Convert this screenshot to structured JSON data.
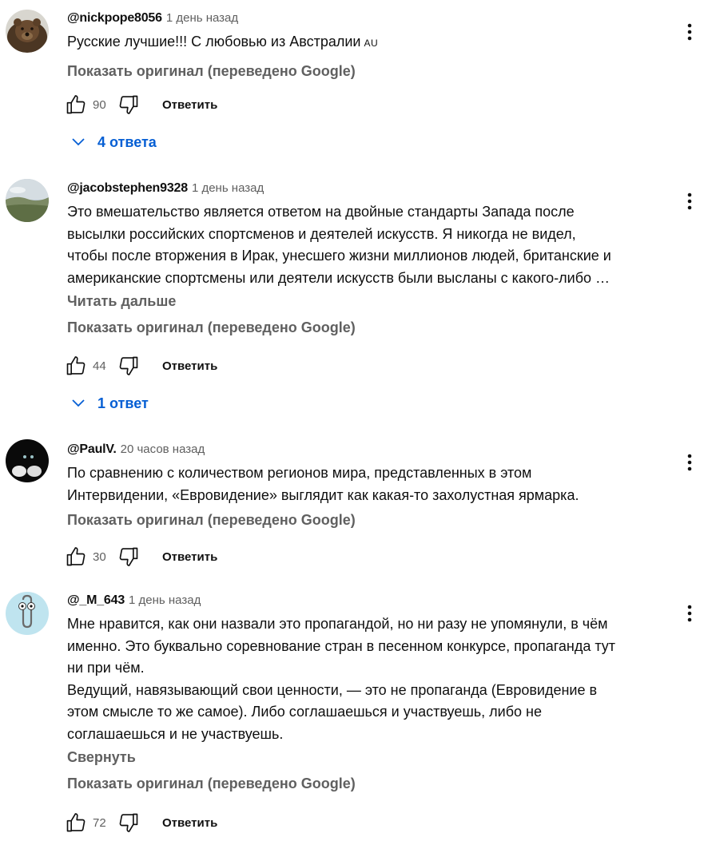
{
  "labels": {
    "show_original": "Показать оригинал (переведено Google)",
    "reply": "Ответить",
    "read_more": "Читать дальше",
    "collapse": "Свернуть"
  },
  "comments": [
    {
      "author": "@nickpope8056",
      "time": "1 день назад",
      "lines": [
        "Русские лучшие!!! С любовью из Австралии"
      ],
      "flag": "AU",
      "likes": "90",
      "replies": "4 ответа"
    },
    {
      "author": "@jacobstephen9328",
      "time": "1 день назад",
      "lines": [
        "Это вмешательство является ответом на двойные стандарты Запада после",
        "высылки российских спортсменов и деятелей искусств. Я никогда не видел,",
        "чтобы после вторжения в Ирак, унесшего жизни миллионов людей, британские и",
        "американские спортсмены или деятели искусств были высланы с какого-либо …"
      ],
      "likes": "44",
      "replies": "1 ответ"
    },
    {
      "author": "@PaulV.",
      "time": "20 часов назад",
      "lines": [
        "По сравнению с количеством регионов мира, представленных в этом",
        "Интервидении, «Евровидение» выглядит как какая-то захолустная ярмарка."
      ],
      "likes": "30"
    },
    {
      "author": "@_M_643",
      "time": "1 день назад",
      "lines": [
        "Мне нравится, как они назвали это пропагандой, но ни разу не упомянули, в чём",
        "именно. Это буквально соревнование стран в песенном конкурсе, пропаганда тут",
        "ни при чём.",
        "Ведущий, навязывающий свои ценности, — это не пропаганда (Евровидение в",
        "этом смысле то же самое). Либо соглашаешься и участвуешь, либо не",
        "соглашаешься и не участвуешь."
      ],
      "likes": "72"
    }
  ]
}
